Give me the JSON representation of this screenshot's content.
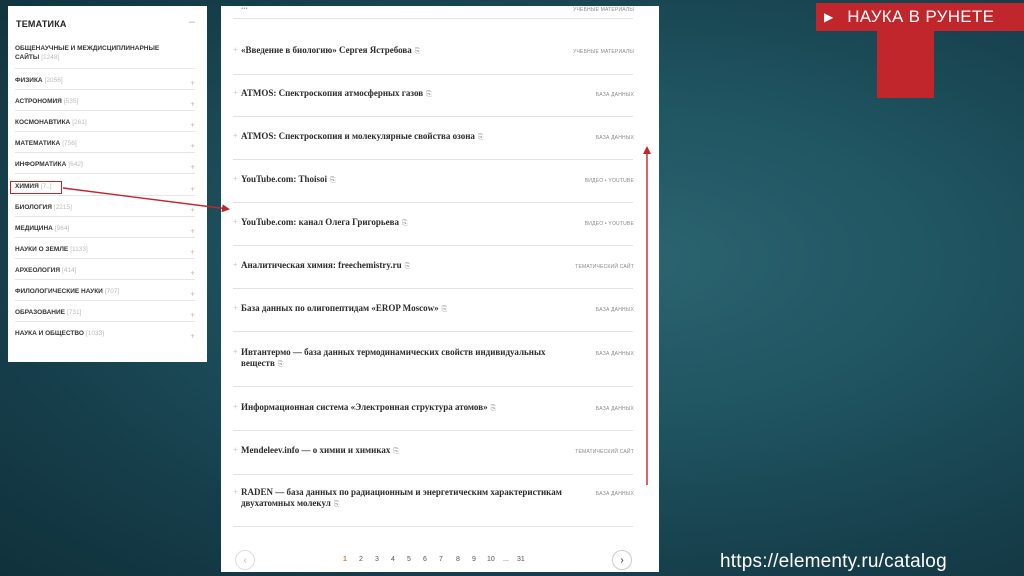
{
  "badge": {
    "title": "НАУКА В РУНЕТЕ",
    "arrow": "▶"
  },
  "url": "https://elementy.ru/catalog",
  "categories": {
    "title": "ТЕМАТИКА",
    "collapse": "–",
    "items": [
      {
        "label": "ОБЩЕНАУЧНЫЕ И МЕЖДИСЦИПЛИНАРНЫЕ САЙТЫ",
        "count": "[1248]"
      },
      {
        "label": "ФИЗИКА",
        "count": "[2056]"
      },
      {
        "label": "АСТРОНОМИЯ",
        "count": "[535]"
      },
      {
        "label": "КОСМОНАВТИКА",
        "count": "[261]"
      },
      {
        "label": "МАТЕМАТИКА",
        "count": "[756]"
      },
      {
        "label": "ИНФОРМАТИКА",
        "count": "[642]"
      },
      {
        "label": "ХИМИЯ",
        "count": "[7..]"
      },
      {
        "label": "БИОЛОГИЯ",
        "count": "[2215]"
      },
      {
        "label": "МЕДИЦИНА",
        "count": "[964]"
      },
      {
        "label": "НАУКИ О ЗЕМЛЕ",
        "count": "[1133]"
      },
      {
        "label": "АРХЕОЛОГИЯ",
        "count": "[414]"
      },
      {
        "label": "ФИЛОЛОГИЧЕСКИЕ НАУКИ",
        "count": "[707]"
      },
      {
        "label": "ОБРАЗОВАНИЕ",
        "count": "[731]"
      },
      {
        "label": "НАУКА И ОБЩЕСТВО",
        "count": "[1033]"
      }
    ]
  },
  "list": {
    "rows": [
      {
        "title": "...",
        "tag": "УЧЕБНЫЕ МАТЕРИАЛЫ"
      },
      {
        "title": "«Введение в биологию» Сергея Ястребова",
        "tag": "УЧЕБНЫЕ МАТЕРИАЛЫ"
      },
      {
        "title": "ATMOS: Спектроскопия атмосферных газов",
        "tag": "БАЗА ДАННЫХ"
      },
      {
        "title": "ATMOS: Спектроскопия и молекулярные свойства озона",
        "tag": "БАЗА ДАННЫХ"
      },
      {
        "title": "YouTube.com: Thoisoi",
        "tag": "ВИДЕО • YOUTUBE"
      },
      {
        "title": "YouTube.com: канал Олега Григорьева",
        "tag": "ВИДЕО • YOUTUBE"
      },
      {
        "title": "Аналитическая химия: freechemistry.ru",
        "tag": "ТЕМАТИЧЕСКИЙ САЙТ"
      },
      {
        "title": "База данных по олигопептидам «EROP Moscow»",
        "tag": "БАЗА ДАННЫХ"
      },
      {
        "title": "Ивтантермо — база данных термодинамических свойств индивидуальных веществ",
        "tag": "БАЗА ДАННЫХ"
      },
      {
        "title": "Информационная система «Электронная структура атомов»",
        "tag": "БАЗА ДАННЫХ"
      },
      {
        "title": "Mendeleev.info — о химии и химиках",
        "tag": "ТЕМАТИЧЕСКИЙ САЙТ"
      },
      {
        "title": "RADEN — база данных по радиационным и энергетическим характеристикам двухатомных молекул",
        "tag": "БАЗА ДАННЫХ"
      }
    ],
    "link_icon": "⎘",
    "plus": "+"
  },
  "pagination": {
    "prev": "‹",
    "next": "›",
    "pages": [
      "1",
      "2",
      "3",
      "4",
      "5",
      "6",
      "7",
      "8",
      "9",
      "10",
      "...",
      "31"
    ],
    "active": "1"
  }
}
